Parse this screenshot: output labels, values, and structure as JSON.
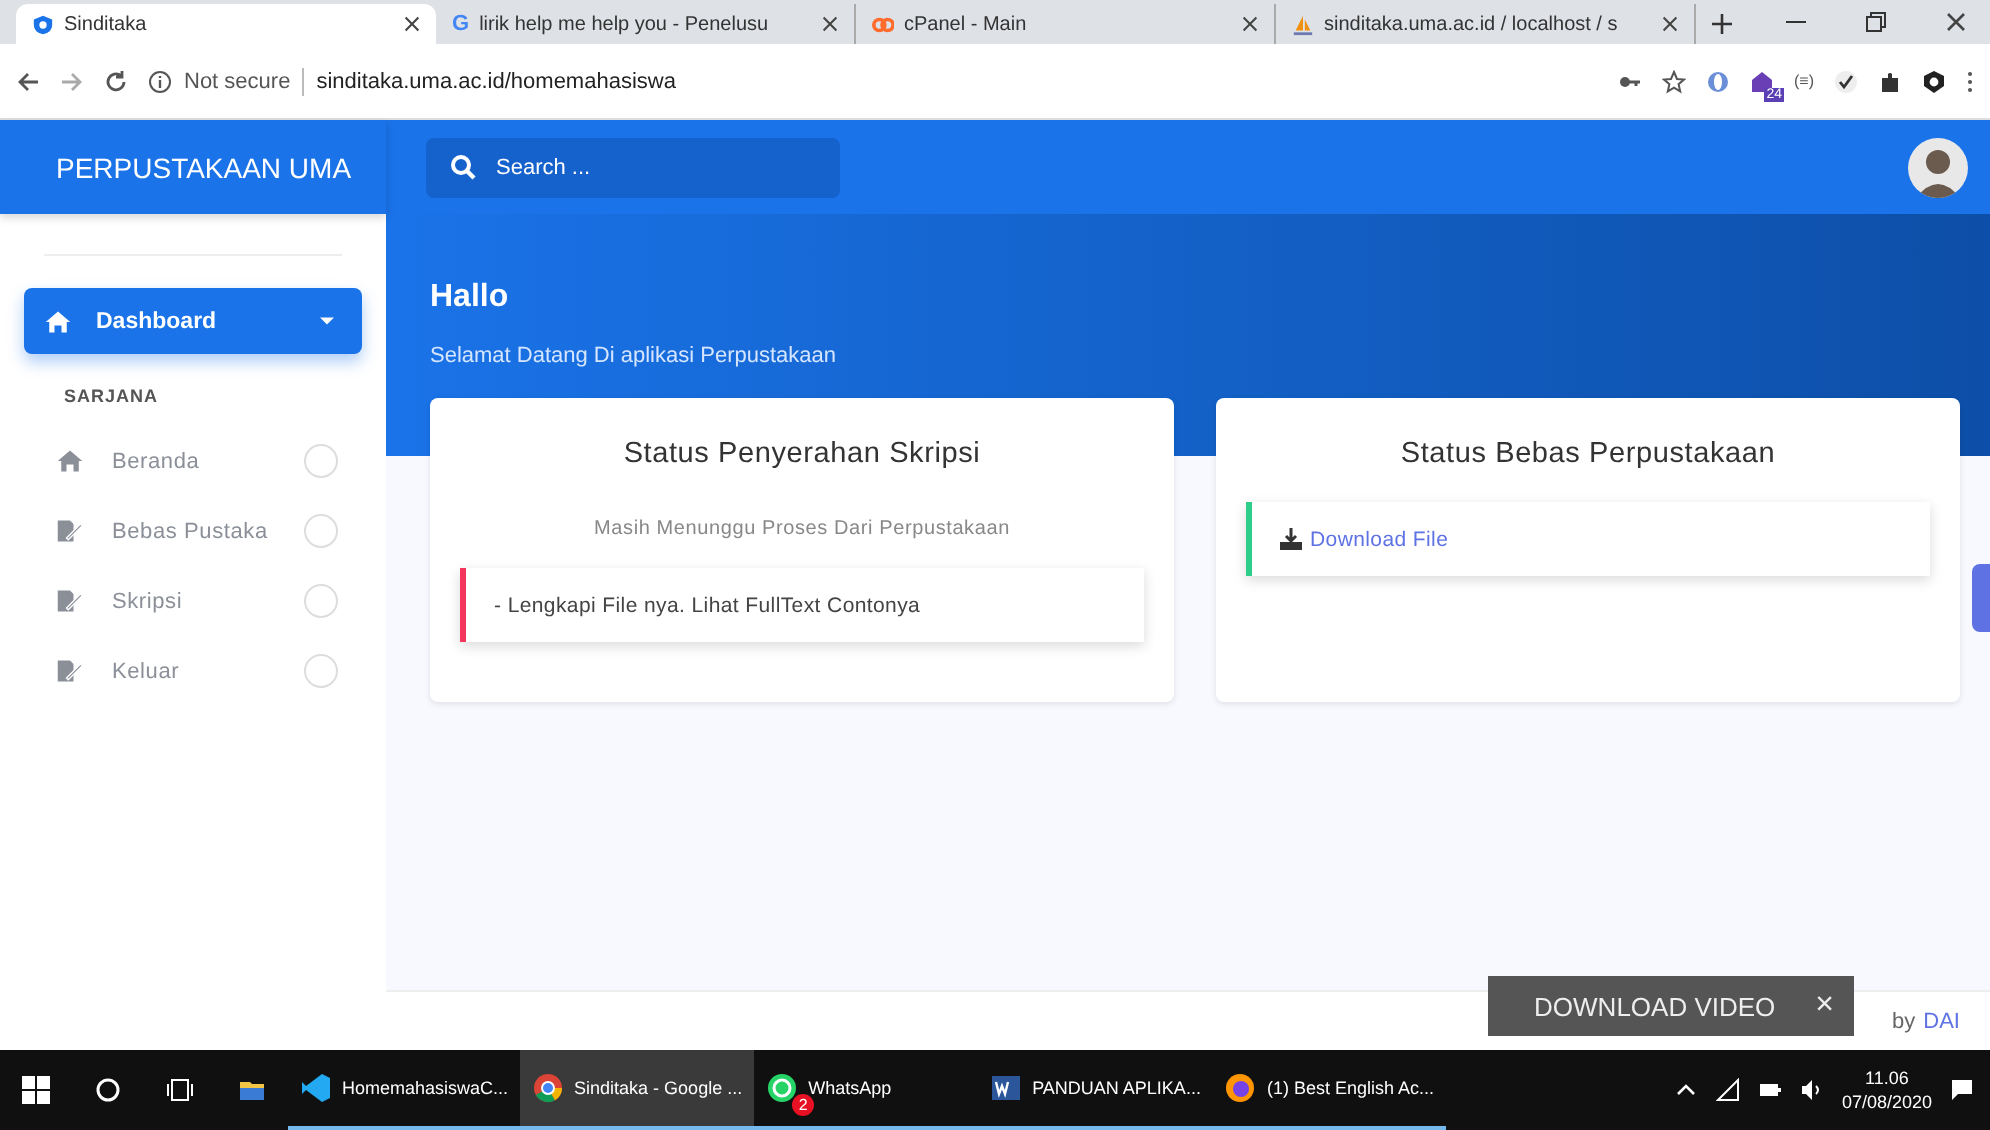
{
  "browser": {
    "tabs": [
      {
        "title": "Sinditaka",
        "selected": true
      },
      {
        "title": "lirik help me help you - Penelusu",
        "selected": false,
        "glyph": "G"
      },
      {
        "title": "cPanel - Main",
        "selected": false
      },
      {
        "title": "sinditaka.uma.ac.id / localhost / s",
        "selected": false
      }
    ],
    "security": "Not secure",
    "url": "sinditaka.uma.ac.id/homemahasiswa",
    "ext_badge": "24",
    "ext_text": "(≡)"
  },
  "app": {
    "brand": "PERPUSTAKAAN UMA",
    "search": {
      "placeholder": "Search ..."
    },
    "sidebar": {
      "main": {
        "label": "Dashboard",
        "selected": true
      },
      "section": "SARJANA",
      "items": [
        {
          "label": "Beranda",
          "selected": false
        },
        {
          "label": "Bebas Pustaka",
          "selected": false
        },
        {
          "label": "Skripsi",
          "selected": false
        },
        {
          "label": "Keluar",
          "selected": false
        }
      ]
    },
    "hero": {
      "title": "Hallo",
      "subtitle": "Selamat Datang Di aplikasi Perpustakaan"
    },
    "cards": [
      {
        "title": "Status Penyerahan Skripsi",
        "note": "Masih Menunggu Proses Dari Perpustakaan",
        "alert": {
          "kind": "text",
          "text": "- Lengkapi File nya. Lihat FullText Contonya",
          "color": "#f5365c"
        }
      },
      {
        "title": "Status Bebas Perpustakaan",
        "alert": {
          "kind": "link",
          "text": "Download File",
          "color": "#2dce89"
        }
      }
    ],
    "footer": {
      "by": "by",
      "name": "DAI"
    }
  },
  "overlay": {
    "label": "DOWNLOAD VIDEO",
    "close": "×"
  },
  "taskbar": {
    "apps": [
      {
        "label": "HomemahasiswaC...",
        "selected": false
      },
      {
        "label": "Sinditaka - Google ...",
        "selected": true
      },
      {
        "label": "WhatsApp",
        "selected": false,
        "badge": "2"
      },
      {
        "label": "PANDUAN APLIKA...",
        "selected": false
      },
      {
        "label": "(1) Best English Ac...",
        "selected": false
      }
    ],
    "time": "11.06",
    "date": "07/08/2020"
  }
}
